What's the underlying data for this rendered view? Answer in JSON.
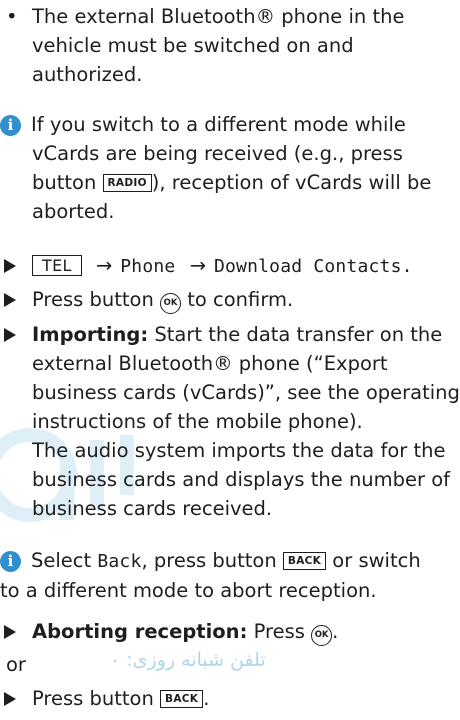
{
  "bullet1": {
    "dot": "•",
    "lines": [
      "The external Bluetooth® phone in the",
      "vehicle must be switched on and",
      "authorized."
    ]
  },
  "note1": {
    "icon": "i",
    "l1": "If you switch to a different mode while",
    "l2": "vCards are being received (e.g., press",
    "l3_pre": "button ",
    "l3_btn": "RADIO",
    "l3_post": "), reception of vCards will be",
    "l4": "aborted."
  },
  "step1": {
    "btn": "TEL",
    "arrow1": "→",
    "menu1": "Phone",
    "arrow2": "→",
    "menu2": "Download Contacts."
  },
  "step2": {
    "pre": "Press button ",
    "btn": "OK",
    "post": " to confirm."
  },
  "step3": {
    "bold": "Importing:",
    "l1": " Start the data transfer on the",
    "l2": "external Bluetooth® phone (“Export",
    "l3": "business cards (vCards)”, see the operating",
    "l4": "instructions of the mobile phone).",
    "l5": "The audio system imports the data for the",
    "l6": "business cards and displays the number of",
    "l7": "business cards received."
  },
  "note2": {
    "icon": "i",
    "pre": "Select ",
    "mono": "Back",
    "mid": ", press button ",
    "btn": "BACK",
    "post": " or switch",
    "l2": "to a different mode to abort reception."
  },
  "step4": {
    "bold": "Aborting reception:",
    "pre": " Press ",
    "btn": "OK",
    "post": "."
  },
  "or_text": "or",
  "step5": {
    "pre": "Press button ",
    "btn": "BACK",
    "post": "."
  },
  "watermark": {
    "text": "تلفن شبانه روزی: ۰",
    "color": "#3ea0d8"
  }
}
